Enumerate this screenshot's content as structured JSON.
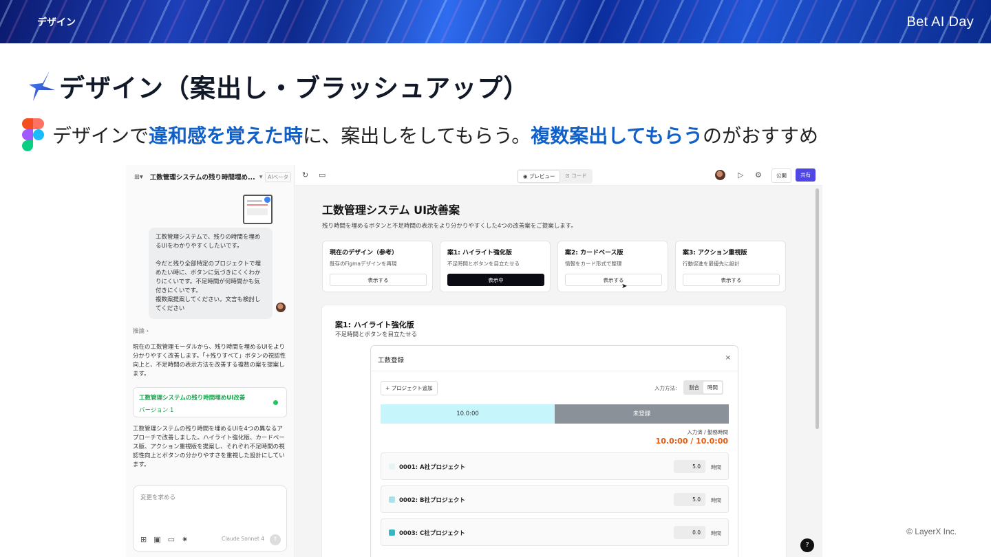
{
  "banner": {
    "section": "デザイン",
    "logo": "Bet AI Day"
  },
  "slide": {
    "title": "デザイン（案出し・ブラッシュアップ）",
    "subtitle": {
      "p1": "デザインで",
      "h1": "違和感を覚えた時",
      "p2": "に、案出しをしてもらう。",
      "h2": "複数案出してもらう",
      "p3": "のがおすすめ"
    },
    "copyright": "© LayerX Inc."
  },
  "chat": {
    "project_title": "工数管理システムの残り時間埋め...",
    "model_badge": "AIベータ",
    "user_message": "工数管理システムで、残りの時間を埋めるUIをわかりやすくしたいです。\n\n今だと残り全部特定のプロジェクトで埋めたい時に、ボタンに気づきにくくわかりにくいです。不足時間が何時間かも気付きにくいです。\n複数案提案してください。文言も検討してください",
    "reasoning_label": "推論 ›",
    "reply_1": "現在の工数管理モーダルから、残り時間を埋めるUIをより分かりやすく改善します。「+残りすべて」ボタンの視認性向上と、不足時間の表示方法を改善する複数の案を提案します。",
    "artifact_title": "工数管理システムの残り時間埋めUI改善",
    "artifact_version": "バージョン 1",
    "reply_2": "工数管理システムの残り時間を埋めるUIを4つの異なるアプローチで改善しました。ハイライト強化版、カードベース版、アクション重視版を提案し、それぞれ不足時間の視認性向上とボタンの分かりやすさを重視した設計にしています。",
    "input_placeholder": "変更を求める",
    "model_name": "Claude Sonnet 4"
  },
  "toolbar": {
    "preview_tab": "プレビュー",
    "code_tab": "コード",
    "publish": "公開",
    "share": "共有"
  },
  "proposal": {
    "title": "工数管理システム UI改善案",
    "description": "残り時間を埋めるボタンと不足時間の表示をより分かりやすくした4つの改善案をご提案します。",
    "cards": [
      {
        "title": "現在のデザイン（参考）",
        "desc": "既存のFigmaデザインを再現",
        "button": "表示する",
        "active": false
      },
      {
        "title": "案1: ハイライト強化版",
        "desc": "不足時間とボタンを目立たせる",
        "button": "表示中",
        "active": true
      },
      {
        "title": "案2: カードベース版",
        "desc": "情報をカード形式で整理",
        "button": "表示する",
        "active": false
      },
      {
        "title": "案3: アクション重視版",
        "desc": "行動促進を最優先に設計",
        "button": "表示する",
        "active": false
      }
    ],
    "panel_title": "案1: ハイライト強化版",
    "panel_sub": "不足時間とボタンを目立たせる"
  },
  "modal": {
    "title": "工数登録",
    "close": "×",
    "add_project": "+ プロジェクト追加",
    "input_method_label": "入力方法:",
    "method_options": [
      "割合",
      "時間"
    ],
    "selected_method": "時間",
    "bar_registered": "10.0:00",
    "bar_unregistered": "未登録",
    "total_label": "入力済 / 勤務時間",
    "total_value": "10.0:00 / 10.0:00",
    "projects": [
      {
        "name": "0001: A社プロジェクト",
        "value": "5.0",
        "unit": "時間",
        "color": "#e6f4f6"
      },
      {
        "name": "0002: B社プロジェクト",
        "value": "5.0",
        "unit": "時間",
        "color": "#a7e3e8"
      },
      {
        "name": "0003: C社プロジェクト",
        "value": "0.0",
        "unit": "時間",
        "color": "#38b6c8"
      }
    ]
  },
  "help": "?"
}
